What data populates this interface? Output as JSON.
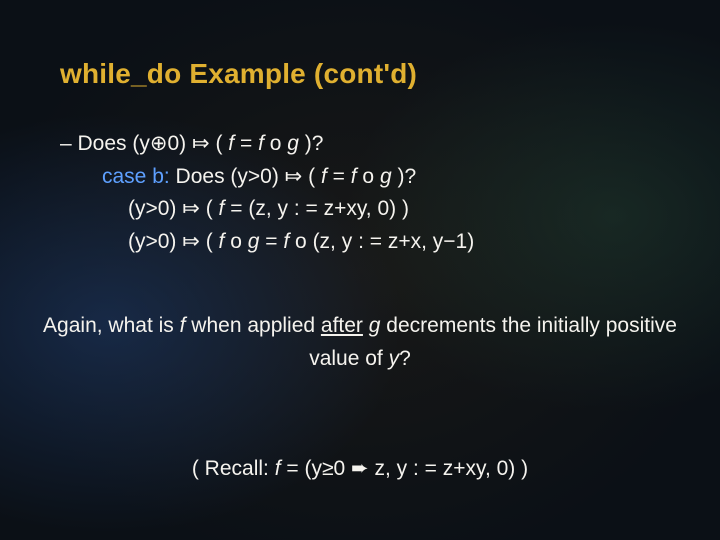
{
  "title": "while_do Example (cont'd)",
  "lines": {
    "l1_dash": "– ",
    "l1_a": "Does (y",
    "l1_sym1": "⊕",
    "l1_b": "0) ",
    "l1_sym2": "⤇",
    "l1_c": " ( ",
    "l1_f1": "f",
    "l1_d": " = ",
    "l1_f2": "f",
    "l1_e": " o ",
    "l1_g": "g",
    "l1_f": " )?",
    "l2_case": "case b: ",
    "l2_a": "Does (y>0) ",
    "l2_sym": "⤇",
    "l2_b": " ( ",
    "l2_f1": "f",
    "l2_c": " = ",
    "l2_f2": "f",
    "l2_d": " o ",
    "l2_g": "g",
    "l2_e": " )?",
    "l3_a": "(y>0) ",
    "l3_sym": "⤇",
    "l3_b": " ( ",
    "l3_f": "f",
    "l3_c": " = (z, y : = z+xy, 0) )",
    "l4_a": "(y>0) ",
    "l4_sym": "⤇",
    "l4_b": " ( ",
    "l4_f1": "f",
    "l4_c": " o ",
    "l4_g": "g",
    "l4_d": " = ",
    "l4_f2": "f",
    "l4_e": " o (z, y : = z+x, y−1)"
  },
  "question": {
    "a": "Again, what is ",
    "f": "f",
    "b": " when applied ",
    "after": "after",
    "c": " ",
    "g": "g",
    "d": " decrements the initially positive value of ",
    "y": "y",
    "e": "?"
  },
  "recall": {
    "a": "( Recall: ",
    "f": "f",
    "b": " = (y≥0 ",
    "sym": "➨",
    "c": " z, y : = z+xy, 0) )"
  }
}
